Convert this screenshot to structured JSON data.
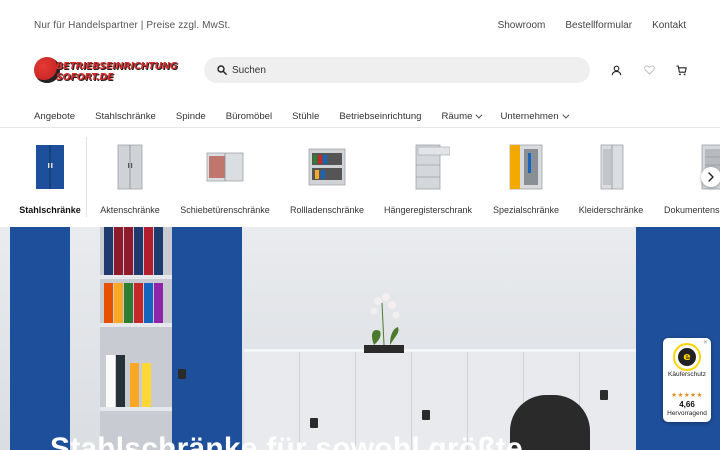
{
  "topbar": {
    "note": "Nur für Handelspartner | Preise zzgl. MwSt.",
    "links": [
      "Showroom",
      "Bestellformular",
      "Kontakt"
    ]
  },
  "header": {
    "logo_line1": "Betriebseinrichtung",
    "logo_line2": "sofort.de",
    "search_placeholder": "Suchen",
    "icons": [
      "account-icon",
      "wishlist-heart-icon",
      "cart-icon"
    ]
  },
  "mainnav": {
    "items": [
      {
        "label": "Angebote",
        "dropdown": false
      },
      {
        "label": "Stahlschränke",
        "dropdown": false
      },
      {
        "label": "Spinde",
        "dropdown": false
      },
      {
        "label": "Büromöbel",
        "dropdown": false
      },
      {
        "label": "Stühle",
        "dropdown": false
      },
      {
        "label": "Betriebseinrichtung",
        "dropdown": false
      },
      {
        "label": "Räume",
        "dropdown": true
      },
      {
        "label": "Unternehmen",
        "dropdown": true
      }
    ]
  },
  "categories": {
    "items": [
      {
        "label": "Stahlschränke",
        "active": true,
        "color": "#1e4f9a"
      },
      {
        "label": "Aktenschränke",
        "active": false,
        "color": "#c9ccd0"
      },
      {
        "label": "Schiebetürenschränke",
        "active": false,
        "color": "#d5d8dc"
      },
      {
        "label": "Rollladenschränke",
        "active": false,
        "color": "#c9ccd0"
      },
      {
        "label": "Hängeregisterschrank",
        "active": false,
        "color": "#c9ccd0"
      },
      {
        "label": "Spezialschränke",
        "active": false,
        "color": "#f2a900"
      },
      {
        "label": "Kleiderschränke",
        "active": false,
        "color": "#d5d8dc"
      },
      {
        "label": "Dokumentenschränke",
        "active": false,
        "color": "#c9ccd0"
      }
    ]
  },
  "hero": {
    "headline": "Stahlschränke für sowohl größte"
  },
  "trust_badge": {
    "seal_letter": "e",
    "label": "Käuferschutz",
    "stars": "★★★★★",
    "score": "4,66",
    "grade": "Hervorragend"
  },
  "colors": {
    "brand_red": "#d32f2f",
    "cabinet_blue": "#1e4f9a",
    "star_orange": "#e38b1f"
  }
}
